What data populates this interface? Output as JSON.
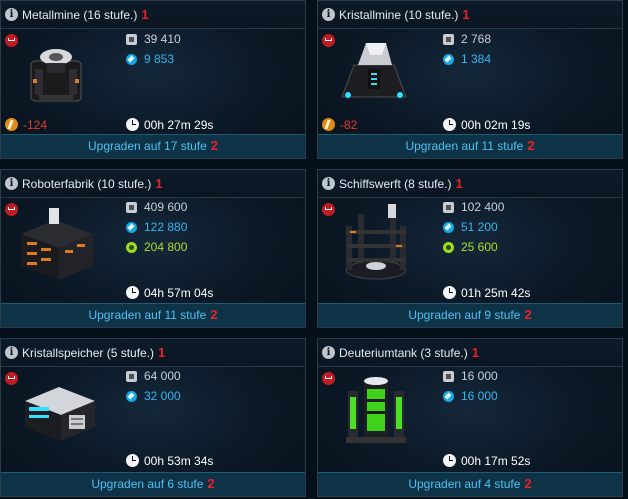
{
  "cards": [
    {
      "title": "Metallmine (16 stufe.)",
      "n1": "1",
      "metal": "39 410",
      "crystal": "9 853",
      "energy": "-124",
      "time": "00h 27m 29s",
      "upgrade": "Upgraden auf 17 stufe",
      "n2": "2"
    },
    {
      "title": "Kristallmine (10 stufe.)",
      "n1": "1",
      "metal": "2 768",
      "crystal": "1 384",
      "energy": "-82",
      "time": "00h 02m 19s",
      "upgrade": "Upgraden auf 11 stufe",
      "n2": "2"
    },
    {
      "title": "Roboterfabrik (10 stufe.)",
      "n1": "1",
      "metal": "409 600",
      "crystal": "122 880",
      "deuterium": "204 800",
      "time": "04h 57m 04s",
      "upgrade": "Upgraden auf 11 stufe",
      "n2": "2"
    },
    {
      "title": "Schiffswerft (8 stufe.)",
      "n1": "1",
      "metal": "102 400",
      "crystal": "51 200",
      "deuterium": "25 600",
      "time": "01h 25m 42s",
      "upgrade": "Upgraden auf 9 stufe",
      "n2": "2"
    },
    {
      "title": "Kristallspeicher (5 stufe.)",
      "n1": "1",
      "metal": "64 000",
      "crystal": "32 000",
      "time": "00h 53m 34s",
      "upgrade": "Upgraden auf 6 stufe",
      "n2": "2"
    },
    {
      "title": "Deuteriumtank (3 stufe.)",
      "n1": "1",
      "metal": "16 000",
      "crystal": "16 000",
      "time": "00h 17m 52s",
      "upgrade": "Upgraden auf 4 stufe",
      "n2": "2"
    }
  ],
  "icons": {
    "info": "info-icon",
    "teardown": "teardown-icon",
    "metal": "metal-icon",
    "crystal": "crystal-icon",
    "deuterium": "deuterium-icon",
    "energy": "energy-icon",
    "time": "clock-icon"
  },
  "colors": {
    "accent": "#4cc0f2",
    "red": "#e8212a",
    "crystal": "#35b6ef",
    "deuterium": "#a7e02a",
    "energy": "#e53a2e"
  }
}
